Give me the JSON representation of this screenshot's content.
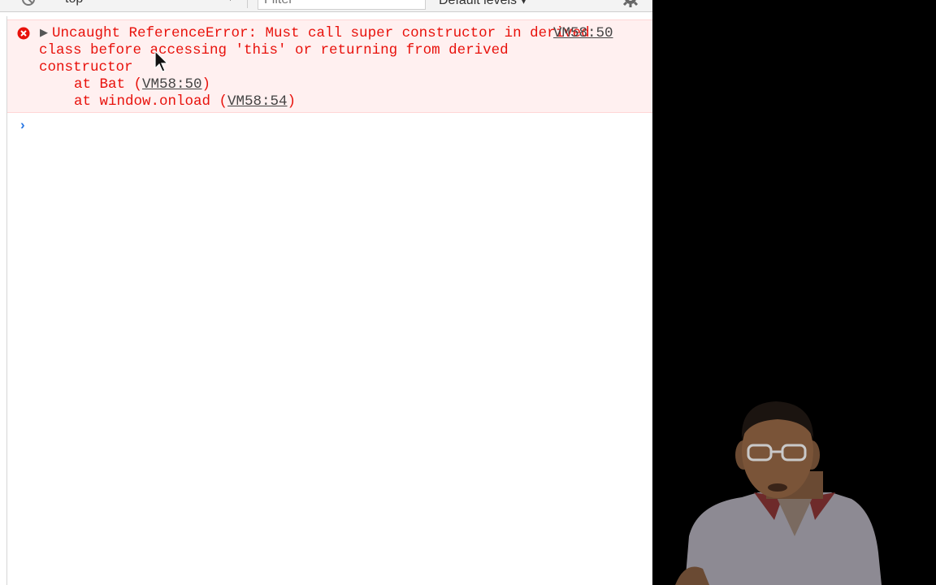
{
  "toolbar": {
    "context_label": "top",
    "filter_placeholder": "Filter",
    "levels_label": "Default levels ▾"
  },
  "console": {
    "error_message": "Uncaught ReferenceError: Must call super constructor in derived class before accessing 'this' or returning from derived constructor",
    "error_source": "VM58:50",
    "stack": [
      {
        "prefix": "at Bat (",
        "link": "VM58:50",
        "suffix": ")"
      },
      {
        "prefix": "at window.onload (",
        "link": "VM58:54",
        "suffix": ")"
      }
    ],
    "prompt": "›"
  },
  "colors": {
    "error_text": "#e8110b",
    "error_bg": "#fff0f0",
    "prompt": "#2b78e4"
  },
  "icons": [
    "clear-console-icon",
    "settings-gear-icon",
    "error-icon",
    "expand-triangle-icon",
    "mouse-cursor-icon"
  ]
}
